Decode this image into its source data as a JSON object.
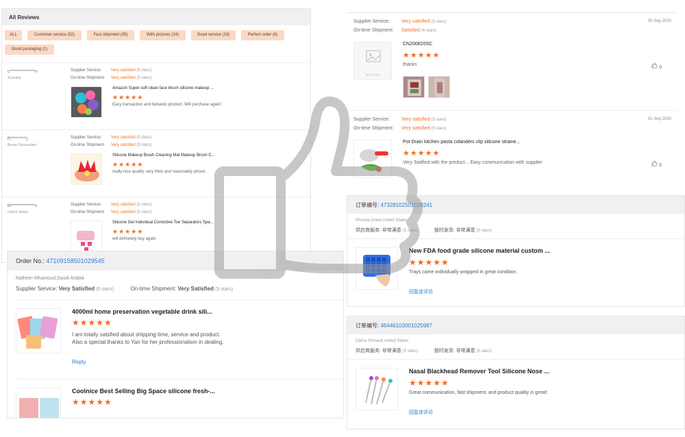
{
  "all_reviews": {
    "header": "All Reviews",
    "filters": [
      "ALL",
      "Customer service (52)",
      "Fast shipment (35)",
      "With pictures (24)",
      "Good service (18)",
      "Perfect order (6)",
      "Good packaging (1)"
    ],
    "supplier_label": "Supplier Service:",
    "shipment_label": "On-time Shipment:",
    "reviews": [
      {
        "user": "c****************n",
        "country": "Australia",
        "supplier_value": "Very satisfied",
        "supplier_stars": "(5 stars)",
        "shipment_value": "Very satisfied",
        "shipment_stars": "(5 stars)",
        "title": "Amazon Super soft clean face brush silicone makeup ...",
        "stars": "★★★★★",
        "comment": "Easy transaction and fantastic product. Will purchase again!"
      },
      {
        "user": "R**********j",
        "country": "Brunei Darussalam",
        "supplier_value": "Very satisfied",
        "supplier_stars": "(5 stars)",
        "shipment_value": "Very satisfied",
        "shipment_stars": "(5 stars)",
        "title": "Silicone Makeup Brush Cleaning Mat Makeup Brush C...",
        "stars": "★★★★★",
        "comment": "really nice quality, very thick and reasonably priced."
      },
      {
        "user": "M***************s",
        "country": "United States",
        "supplier_value": "Very satisfied",
        "supplier_stars": "(5 stars)",
        "shipment_value": "Very satisfied",
        "shipment_stars": "(5 stars)",
        "title": "Silicone Gel Individual Corrective Toe Separators Spa...",
        "stars": "★★★★★",
        "comment": "will definetely buy again."
      }
    ]
  },
  "order_panel": {
    "order_label": "Order No.:",
    "order_number": "47109158501029545",
    "buyer": "Natheer Alhamoud,Saudi Arabia",
    "supplier_label": "Supplier Service:",
    "supplier_value": "Very Satisfied",
    "supplier_stars": "(5 stars)",
    "shipment_label": "On-time Shipment:",
    "shipment_value": "Very Satisfied",
    "shipment_stars": "(5 stars)",
    "items": [
      {
        "title": "4000ml home preservation vegetable drink sili...",
        "stars": "★★★★★",
        "comment1": "I am totally satsfied about shipping time, service and product.",
        "comment2": "Also a special thanks to Yan for her professionalism in dealing.",
        "reply": "Reply"
      },
      {
        "title": "Coolnice Best Selling Big Space silicone fresh-...",
        "stars": "★★★★★"
      }
    ]
  },
  "right_top": {
    "reviews": [
      {
        "supplier_label": "Supplier Service:",
        "supplier_value": "Very satisfied",
        "supplier_stars": "(5 stars)",
        "shipment_label": "On-time Shipment:",
        "shipment_value": "Satisfied",
        "shipment_stars": "(4 stars)",
        "date": "02 Sep 2020",
        "no_photo": "No Photo",
        "title": "CN200820SC",
        "stars": "★★★★★",
        "comment": "thanks",
        "likes": "0"
      },
      {
        "supplier_label": "Supplier Service:",
        "supplier_value": "Very satisfied",
        "supplier_stars": "(5 stars)",
        "shipment_label": "On-time Shipment:",
        "shipment_value": "Very satisfied",
        "shipment_stars": "(5 stars)",
        "date": "01 Sep 2020",
        "title": "Pot Drain kitchen pasta colanders clip silicone straine...",
        "stars": "★★★★★",
        "comment": "Very Satified with the product... Easy communication with supplier",
        "likes": "0"
      }
    ]
  },
  "cn_orders": [
    {
      "order_label": "订单编号:",
      "order_number": "47328102501028241",
      "buyer": "Rhonda Greer,United States",
      "supplier_label": "供应商服务:",
      "supplier_value": "非常满意",
      "supplier_stars": "(5 stars)",
      "shipment_label": "按时发货:",
      "shipment_value": "非常满意",
      "shipment_stars": "(5 stars)",
      "title": "New FDA food grade silicone material custom ...",
      "stars": "★★★★★",
      "comment": "Trays came individually wrapped in great condition.",
      "reply": "回复该评论"
    },
    {
      "order_label": "订单编号:",
      "order_number": "46446103001025987",
      "buyer": "Cierra Shinault,United States",
      "supplier_label": "供应商服务:",
      "supplier_value": "非常满意",
      "supplier_stars": "(5 stars)",
      "shipment_label": "按时发货:",
      "shipment_value": "非常满意",
      "shipment_stars": "(5 stars)",
      "title": "Nasal Blackhead Remover Tool Silicone Nose ...",
      "stars": "★★★★★",
      "comment": "Great communication, fast shipment, and product quality is great!",
      "reply": "回复该评论"
    }
  ],
  "colors": {
    "accent": "#f26d21",
    "link": "#2a7bd1",
    "chip_bg": "#fbd9c4",
    "header_bg": "#f0f0f0"
  },
  "watermark_icon": "thumbs-up-icon"
}
